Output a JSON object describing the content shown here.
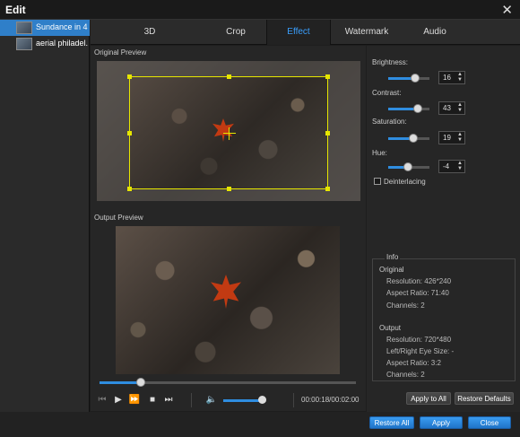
{
  "window": {
    "title": "Edit"
  },
  "files": [
    {
      "label": "Sundance in 4...",
      "active": true
    },
    {
      "label": "aerial philadel...",
      "active": false
    }
  ],
  "tabs": [
    {
      "label": "3D"
    },
    {
      "label": "Crop"
    },
    {
      "label": "Effect",
      "active": true
    },
    {
      "label": "Watermark"
    },
    {
      "label": "Audio"
    }
  ],
  "preview": {
    "original_label": "Original Preview",
    "output_label": "Output Preview"
  },
  "playback": {
    "time": "00:00:18/00:02:00",
    "seek_fraction": 0.16,
    "volume_fraction": 0.9
  },
  "effects": {
    "brightness": {
      "label": "Brightness:",
      "value": "16",
      "fraction": 0.66
    },
    "contrast": {
      "label": "Contrast:",
      "value": "43",
      "fraction": 0.72
    },
    "saturation": {
      "label": "Saturation:",
      "value": "19",
      "fraction": 0.6
    },
    "hue": {
      "label": "Hue:",
      "value": "-4",
      "fraction": 0.48
    },
    "deinterlacing_label": "Deinterlacing",
    "deinterlacing_checked": false
  },
  "info": {
    "title": "Info",
    "original_title": "Original",
    "original_resolution": "Resolution: 426*240",
    "original_aspect": "Aspect Ratio: 71:40",
    "original_channels": "Channels: 2",
    "output_title": "Output",
    "output_resolution": "Resolution: 720*480",
    "output_eye_size": "Left/Right Eye Size: -",
    "output_aspect": "Aspect Ratio: 3:2",
    "output_channels": "Channels: 2"
  },
  "buttons": {
    "apply_all": "Apply to All",
    "restore_defaults": "Restore Defaults",
    "restore_all": "Restore All",
    "apply": "Apply",
    "close": "Close"
  },
  "colors": {
    "accent": "#2f8de0",
    "crop_box": "#e6e600",
    "active_tab": "#3aa0ff"
  }
}
